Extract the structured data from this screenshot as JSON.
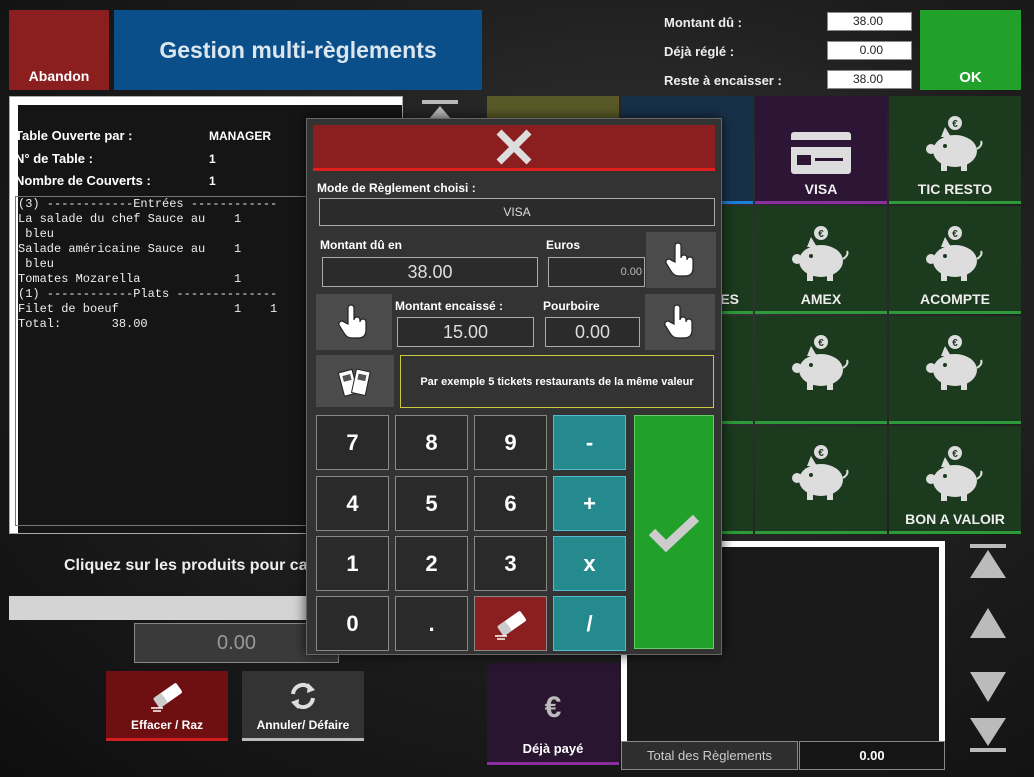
{
  "header": {
    "abandon_label": "Abandon",
    "title": "Gestion multi-règlements",
    "ok_label": "OK",
    "summary": [
      {
        "label": "Montant dû :",
        "value": "38.00"
      },
      {
        "label": "Déjà réglé :",
        "value": "0.00"
      },
      {
        "label": "Reste à encaisser :",
        "value": "38.00"
      }
    ]
  },
  "ticket": {
    "info": [
      {
        "label": "Table Ouverte par :",
        "value": "MANAGER"
      },
      {
        "label": "N° de Table :",
        "value": "1"
      },
      {
        "label": "Nombre de Couverts :",
        "value": "1"
      }
    ],
    "lines": [
      "(3) ------------Entrées ------------",
      "La salade du chef Sauce au    1",
      " bleu",
      "Salade américaine Sauce au    1",
      " bleu",
      "Tomates Mozarella             1",
      "(1) ------------Plats --------------",
      "Filet de boeuf                1    1",
      "",
      "Total:       38.00"
    ]
  },
  "bottom_left": {
    "hint": "Cliquez sur les produits pour ca",
    "amount": "0.00",
    "effacer_label": "Effacer / Raz",
    "annuler_label": "Annuler/ Défaire"
  },
  "payments": {
    "visa": "VISA",
    "tic_resto": "TIC RESTO",
    "partial_es": "ES",
    "amex": "AMEX",
    "acompte": "ACOMPTE",
    "bon_a_valoir": "BON A VALOIR",
    "deja_paye": "Déjà payé"
  },
  "totals": {
    "label": "Total des Règlements",
    "value": "0.00"
  },
  "modal": {
    "mode_label": "Mode de Règlement choisi :",
    "mode_value": "VISA",
    "due_label": "Montant dû en",
    "due_value": "38.00",
    "euros_label": "Euros",
    "euros_value": "0.00",
    "cashed_label": "Montant encaissé :",
    "cashed_value": "15.00",
    "tip_label": "Pourboire",
    "tip_value": "0.00",
    "ticket_hint": "Par exemple 5 tickets restaurants de la même valeur",
    "keys": {
      "k7": "7",
      "k8": "8",
      "k9": "9",
      "minus": "-",
      "k4": "4",
      "k5": "5",
      "k6": "6",
      "plus": "+",
      "k1": "1",
      "k2": "2",
      "k3": "3",
      "times": "x",
      "k0": "0",
      "dot": ".",
      "divide": "/"
    }
  }
}
